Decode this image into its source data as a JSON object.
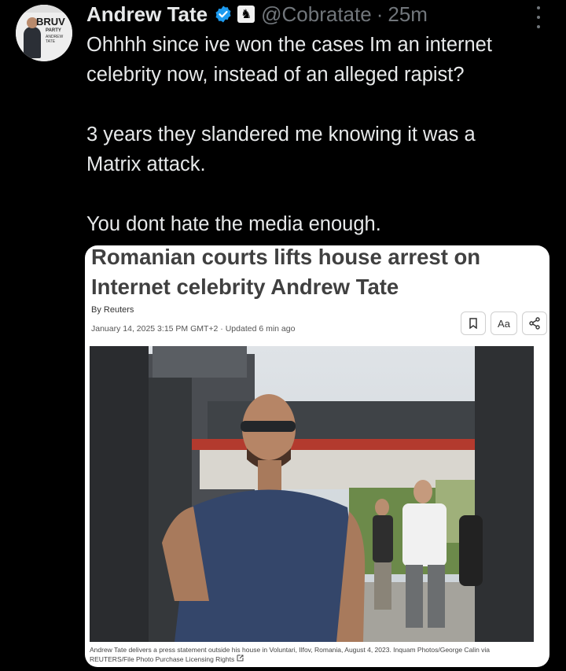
{
  "tweet": {
    "display_name": "Andrew Tate",
    "handle": "@Cobratate",
    "separator": "·",
    "time": "25m",
    "lines": [
      "Ohhhh since ive won the cases Im an internet",
      "celebrity now, instead of an alleged rapist?",
      "",
      "3 years they slandered me knowing it was a",
      "Matrix attack.",
      "",
      "You dont hate the media enough."
    ]
  },
  "avatar": {
    "logo_text": "BRUV",
    "party_text": "PARTY",
    "sub_text": "ANDREW TATE"
  },
  "article": {
    "headline_line1": "Romanian courts lifts house arrest on",
    "headline_line2": "Internet celebrity Andrew Tate",
    "byline": "By Reuters",
    "dateline": "January 14, 2025 3:15 PM GMT+2 · Updated 6 min ago",
    "font_size_label": "Aa",
    "caption_line1": "Andrew Tate delivers a press statement outside his house in Voluntari, Ilfov, Romania, August 4, 2023. Inquam Photos/George Calin via",
    "caption_line2": "REUTERS/File Photo Purchase Licensing Rights"
  },
  "icons": {
    "verified": "verified-badge-icon",
    "affiliate": "chess-knight-icon",
    "more": "more-icon",
    "bookmark": "bookmark-icon",
    "share": "share-icon",
    "external": "external-link-icon"
  },
  "colors": {
    "background": "#000000",
    "text": "#e7e9ea",
    "muted": "#71767b",
    "verified": "#1d9bf0"
  }
}
